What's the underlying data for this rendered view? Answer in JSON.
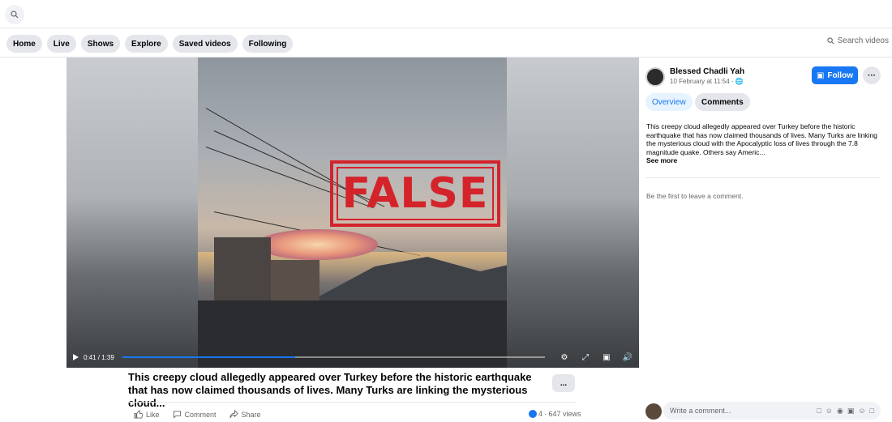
{
  "nav": {
    "items": [
      "Home",
      "Live",
      "Shows",
      "Explore",
      "Saved videos",
      "Following"
    ],
    "search_label": "Search videos"
  },
  "video": {
    "overlay_text": "FALSE",
    "time": "0:41 / 1:39",
    "progress": 0.41
  },
  "post": {
    "caption": "This creepy cloud allegedly appeared over Turkey before the historic earthquake that has now claimed thousands of lives. Many Turks are linking the mysterious cloud...",
    "more_label": "...",
    "actions": {
      "like": "Like",
      "comment": "Comment",
      "share": "Share"
    },
    "reactions_count": "4",
    "views": "· 647 views"
  },
  "panel": {
    "author": "Blessed Chadli Yah",
    "date": "10 February at 11:54 ·",
    "follow_label": "Follow",
    "more_label": "···",
    "tabs": {
      "overview": "Overview",
      "comments": "Comments"
    },
    "description": "This creepy cloud allegedly appeared over Turkey before the historic earthquake that has now claimed thousands of lives. Many Turks are linking the mysterious cloud with the Apocalyptic loss of lives through the 7.8 magnitude quake. Others say Americ...",
    "see_more": "See more",
    "first_comment": "Be the first to leave a comment.",
    "comment_placeholder": "Write a comment..."
  },
  "colors": {
    "accent": "#1877f2",
    "stamp": "#d4232b"
  },
  "icons": [
    "search-icon",
    "play-icon",
    "settings-icon",
    "fullscreen-icon",
    "pip-icon",
    "volume-icon",
    "like-icon",
    "comment-icon",
    "share-icon",
    "globe-icon",
    "follow-icon"
  ]
}
